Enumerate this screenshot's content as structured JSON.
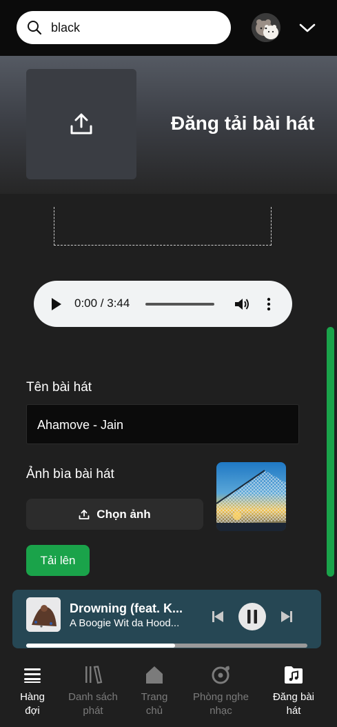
{
  "search": {
    "value": "black",
    "placeholder": ""
  },
  "header": {
    "title": "Đăng tải bài hát"
  },
  "audio": {
    "time": "0:00 / 3:44"
  },
  "form": {
    "song_name_label": "Tên bài hát",
    "song_name_value": "Ahamove - Jain",
    "cover_label": "Ảnh bìa bài hát",
    "choose_image_label": "Chọn ảnh",
    "upload_label": "Tải lên"
  },
  "now_playing": {
    "title": "Drowning (feat. K...",
    "artist": "A Boogie Wit da Hood...",
    "progress": 0.53
  },
  "nav": {
    "items": [
      {
        "line1": "Hàng",
        "line2": "đợi",
        "icon": "queue-icon",
        "active": true
      },
      {
        "line1": "Danh sách",
        "line2": "phát",
        "icon": "library-icon",
        "active": false
      },
      {
        "line1": "Trang",
        "line2": "chủ",
        "icon": "home-icon",
        "active": false
      },
      {
        "line1": "Phòng nghe",
        "line2": "nhạc",
        "icon": "listening-room-icon",
        "active": false
      },
      {
        "line1": "Đăng bài",
        "line2": "hát",
        "icon": "upload-song-icon",
        "active": true
      }
    ]
  },
  "colors": {
    "accent": "#1aa34a",
    "player_bg": "#264754",
    "background": "#1f1f1f",
    "topbar": "#0b0b0b"
  }
}
